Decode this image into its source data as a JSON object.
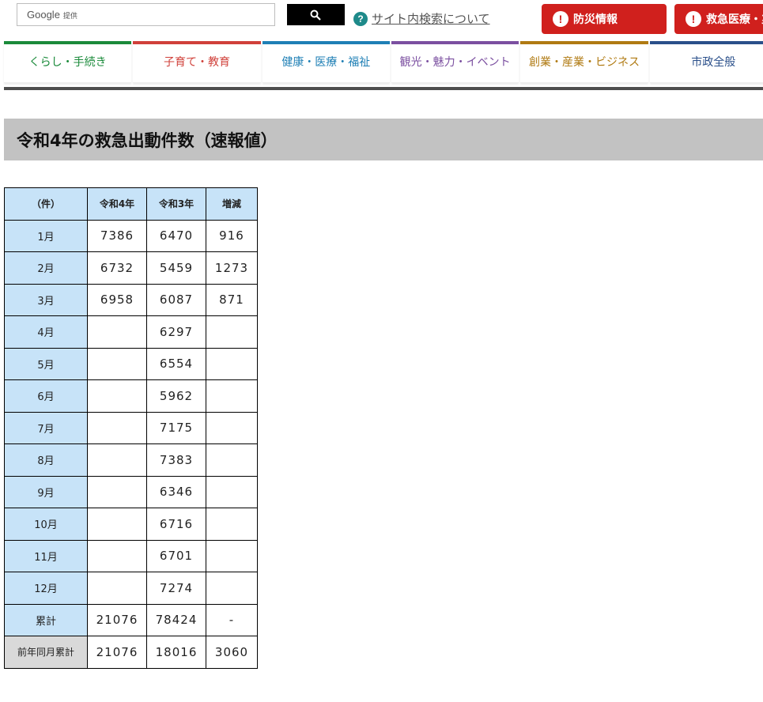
{
  "search": {
    "brand": "Google",
    "provided": "提供",
    "placeholder": "",
    "help_link": "サイト内検索について"
  },
  "alerts": [
    {
      "label": "防災情報",
      "color": "#d0201d"
    },
    {
      "label": "救急医療・災",
      "color": "#d0201d"
    }
  ],
  "nav": {
    "tabs": [
      {
        "label": "くらし・手続き",
        "color": "#1a8a3a"
      },
      {
        "label": "子育て・教育",
        "color": "#d0403a"
      },
      {
        "label": "健康・医療・福祉",
        "color": "#1e7fb5"
      },
      {
        "label": "観光・魅力・イベント",
        "color": "#7b4fa0"
      },
      {
        "label": "創業・産業・ビジネス",
        "color": "#b07a12"
      },
      {
        "label": "市政全般",
        "color": "#2a4f8a"
      }
    ]
  },
  "page": {
    "title": "令和4年の救急出動件数（速報値）"
  },
  "table": {
    "headers": [
      "（件）",
      "令和4年",
      "令和3年",
      "増減"
    ],
    "rows": [
      {
        "label": "1月",
        "r4": "7386",
        "r3": "6470",
        "diff": "916"
      },
      {
        "label": "2月",
        "r4": "6732",
        "r3": "5459",
        "diff": "1273"
      },
      {
        "label": "3月",
        "r4": "6958",
        "r3": "6087",
        "diff": "871"
      },
      {
        "label": "4月",
        "r4": "",
        "r3": "6297",
        "diff": ""
      },
      {
        "label": "5月",
        "r4": "",
        "r3": "6554",
        "diff": ""
      },
      {
        "label": "6月",
        "r4": "",
        "r3": "5962",
        "diff": ""
      },
      {
        "label": "7月",
        "r4": "",
        "r3": "7175",
        "diff": ""
      },
      {
        "label": "8月",
        "r4": "",
        "r3": "7383",
        "diff": ""
      },
      {
        "label": "9月",
        "r4": "",
        "r3": "6346",
        "diff": ""
      },
      {
        "label": "10月",
        "r4": "",
        "r3": "6716",
        "diff": ""
      },
      {
        "label": "11月",
        "r4": "",
        "r3": "6701",
        "diff": ""
      },
      {
        "label": "12月",
        "r4": "",
        "r3": "7274",
        "diff": ""
      },
      {
        "label": "累計",
        "r4": "21076",
        "r3": "78424",
        "diff": "-"
      },
      {
        "label": "前年同月累計",
        "r4": "21076",
        "r3": "18016",
        "diff": "3060"
      }
    ]
  },
  "colors": {
    "header_cell": "#c7e3f8",
    "prev_row_cell": "#d9d9d9",
    "title_bar": "#c2c2c2",
    "alert": "#d0201d"
  }
}
